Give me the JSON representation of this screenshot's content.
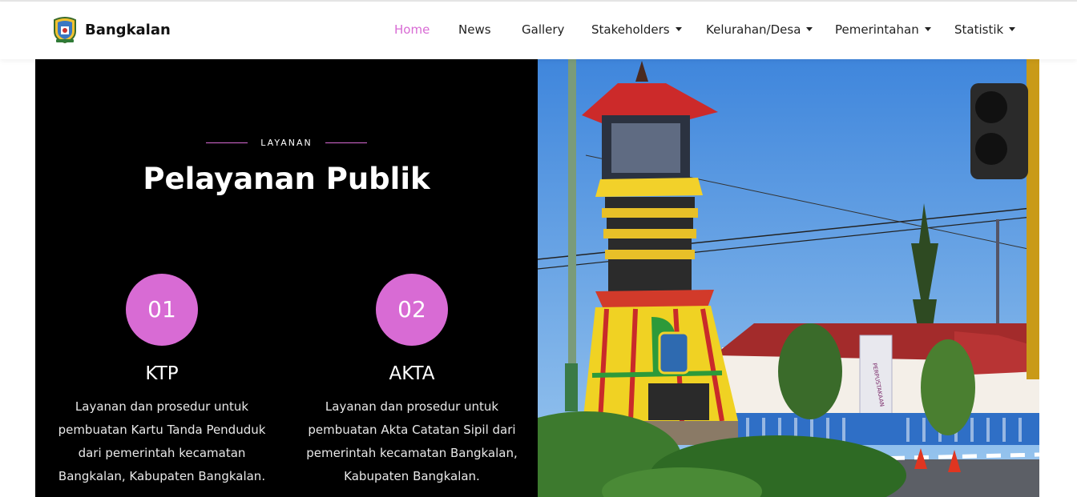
{
  "brand": {
    "name": "Bangkalan",
    "logo_icon": "coat-of-arms-icon"
  },
  "nav": {
    "items": [
      {
        "label": "Home",
        "active": true,
        "dropdown": false
      },
      {
        "label": "News",
        "active": false,
        "dropdown": false
      },
      {
        "label": "Gallery",
        "active": false,
        "dropdown": false
      },
      {
        "label": "Stakeholders",
        "active": false,
        "dropdown": true
      },
      {
        "label": "Kelurahan/Desa",
        "active": false,
        "dropdown": true
      },
      {
        "label": "Pemerintahan",
        "active": false,
        "dropdown": true
      },
      {
        "label": "Statistik",
        "active": false,
        "dropdown": true
      }
    ]
  },
  "section": {
    "eyebrow": "LAYANAN",
    "title": "Pelayanan Publik"
  },
  "services": [
    {
      "number": "01",
      "title": "KTP",
      "description": "Layanan dan prosedur untuk pembuatan Kartu Tanda Penduduk dari pemerintah kecamatan Bangkalan, Kabupaten Bangkalan."
    },
    {
      "number": "02",
      "title": "AKTA",
      "description": "Layanan dan prosedur untuk pembuatan Akta Catatan Sipil dari pemerintah kecamatan Bangkalan, Kabupaten Bangkalan."
    }
  ],
  "photo": {
    "banner_text": "PERPUSTAKAAN"
  },
  "colors": {
    "accent": "#d86bd4",
    "panel": "#000000",
    "text_dark": "#222222"
  }
}
